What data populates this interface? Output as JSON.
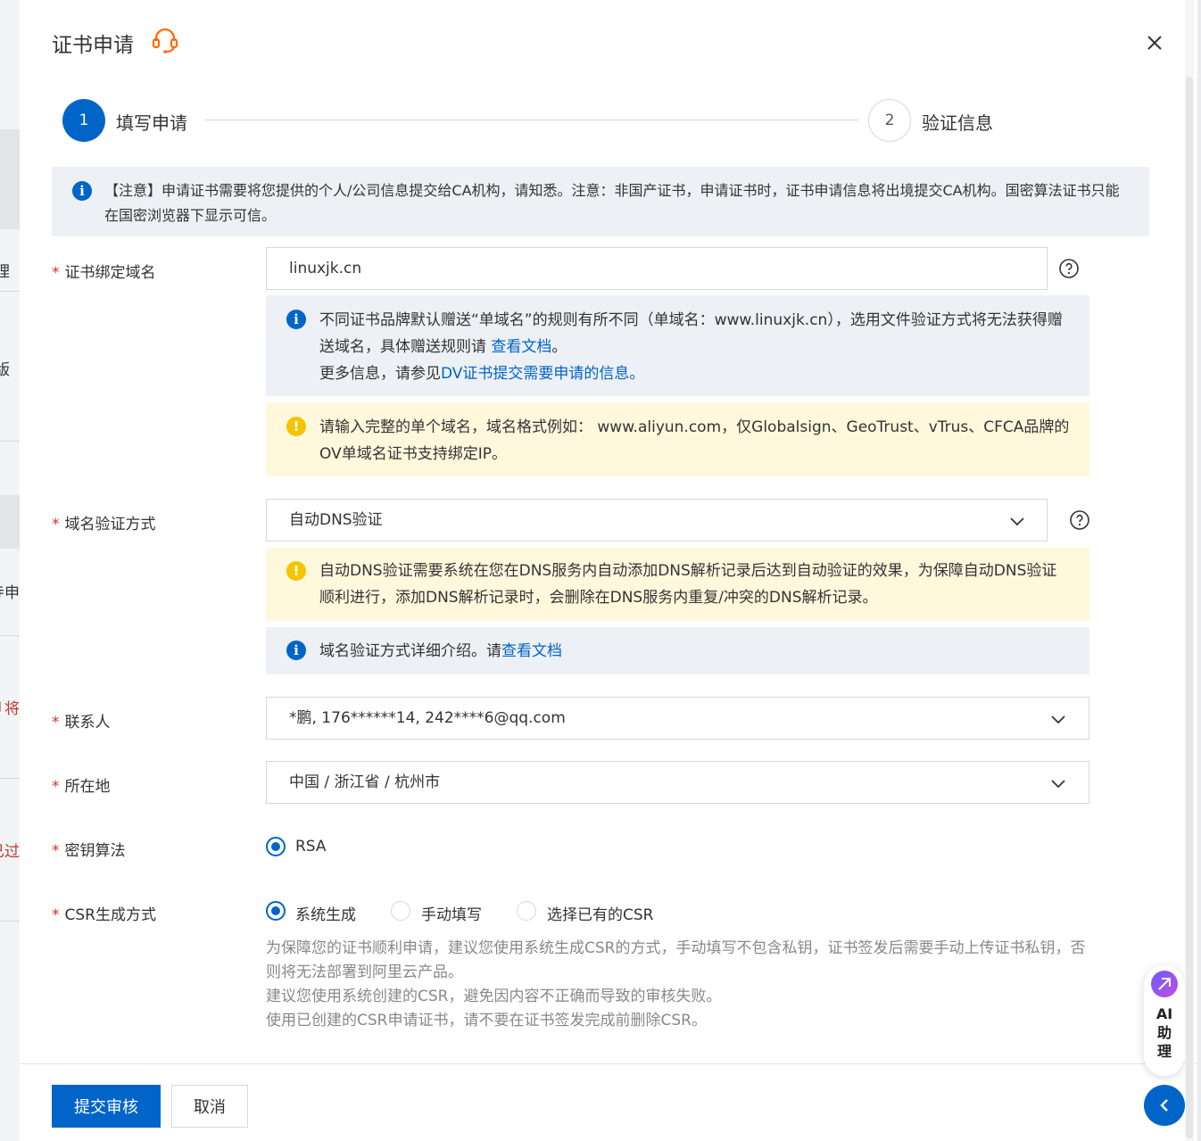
{
  "dialog": {
    "title": "证书申请"
  },
  "steps": [
    {
      "number": "1",
      "label": "填写申请",
      "active": true
    },
    {
      "number": "2",
      "label": "验证信息",
      "active": false
    }
  ],
  "notice": {
    "text": "【注意】申请证书需要将您提供的个人/公司信息提交给CA机构，请知悉。注意：非国产证书，申请证书时，证书申请信息将出境提交CA机构。国密算法证书只能在国密浏览器下显示可信。"
  },
  "domain": {
    "label": "证书绑定域名",
    "required": "*",
    "value": "linuxjk.cn",
    "info": {
      "line1": "不同证书品牌默认赠送“单域名”的规则有所不同（单域名：www.linuxjk.cn），选用文件验证方式将无法获得赠送域名，具体赠送规则请 ",
      "link1": "查看文档",
      "line1_end": "。",
      "line2_prefix": "更多信息，请参见",
      "link2": "DV证书提交需要申请的信息。"
    },
    "warning": "请输入完整的单个域名，域名格式例如： www.aliyun.com，仅Globalsign、GeoTrust、vTrus、CFCA品牌的OV单域名证书支持绑定IP。"
  },
  "verify": {
    "label": "域名验证方式",
    "required": "*",
    "value": "自动DNS验证",
    "warning": "自动DNS验证需要系统在您在DNS服务内自动添加DNS解析记录后达到自动验证的效果，为保障自动DNS验证顺利进行，添加DNS解析记录时，会删除在DNS服务内重复/冲突的DNS解析记录。",
    "info_prefix": "域名验证方式详细介绍。请",
    "info_link": "查看文档"
  },
  "contact": {
    "label": "联系人",
    "required": "*",
    "value": "*鹏, 176******14, 242****6@qq.com"
  },
  "location": {
    "label": "所在地",
    "required": "*",
    "value": "中国 / 浙江省 / 杭州市"
  },
  "algorithm": {
    "label": "密钥算法",
    "required": "*",
    "option": "RSA"
  },
  "csr": {
    "label": "CSR生成方式",
    "required": "*",
    "options": [
      "系统生成",
      "手动填写",
      "选择已有的CSR"
    ],
    "selected": "系统生成",
    "hint1": "为保障您的证书顺利申请，建议您使用系统生成CSR的方式，手动填写不包含私钥，证书签发后需要手动上传证书私钥，否则将无法部署到阿里云产品。",
    "hint2": "建议您使用系统创建的CSR，避免因内容不正确而导致的审核失败。",
    "hint3": "使用已创建的CSR申请证书，请不要在证书签发完成前删除CSR。"
  },
  "footer": {
    "submit": "提交审核",
    "cancel": "取消"
  },
  "ai_assistant": {
    "line1": "AI",
    "line2": "助",
    "line3": "理"
  },
  "background": {
    "fragments": [
      "理",
      "版",
      "：",
      "寺申",
      "卩将",
      "已过"
    ]
  },
  "colors": {
    "primary": "#0064c8",
    "required": "#d93026",
    "warning_bg": "#fff8dc",
    "info_bg": "#edf0f5"
  }
}
